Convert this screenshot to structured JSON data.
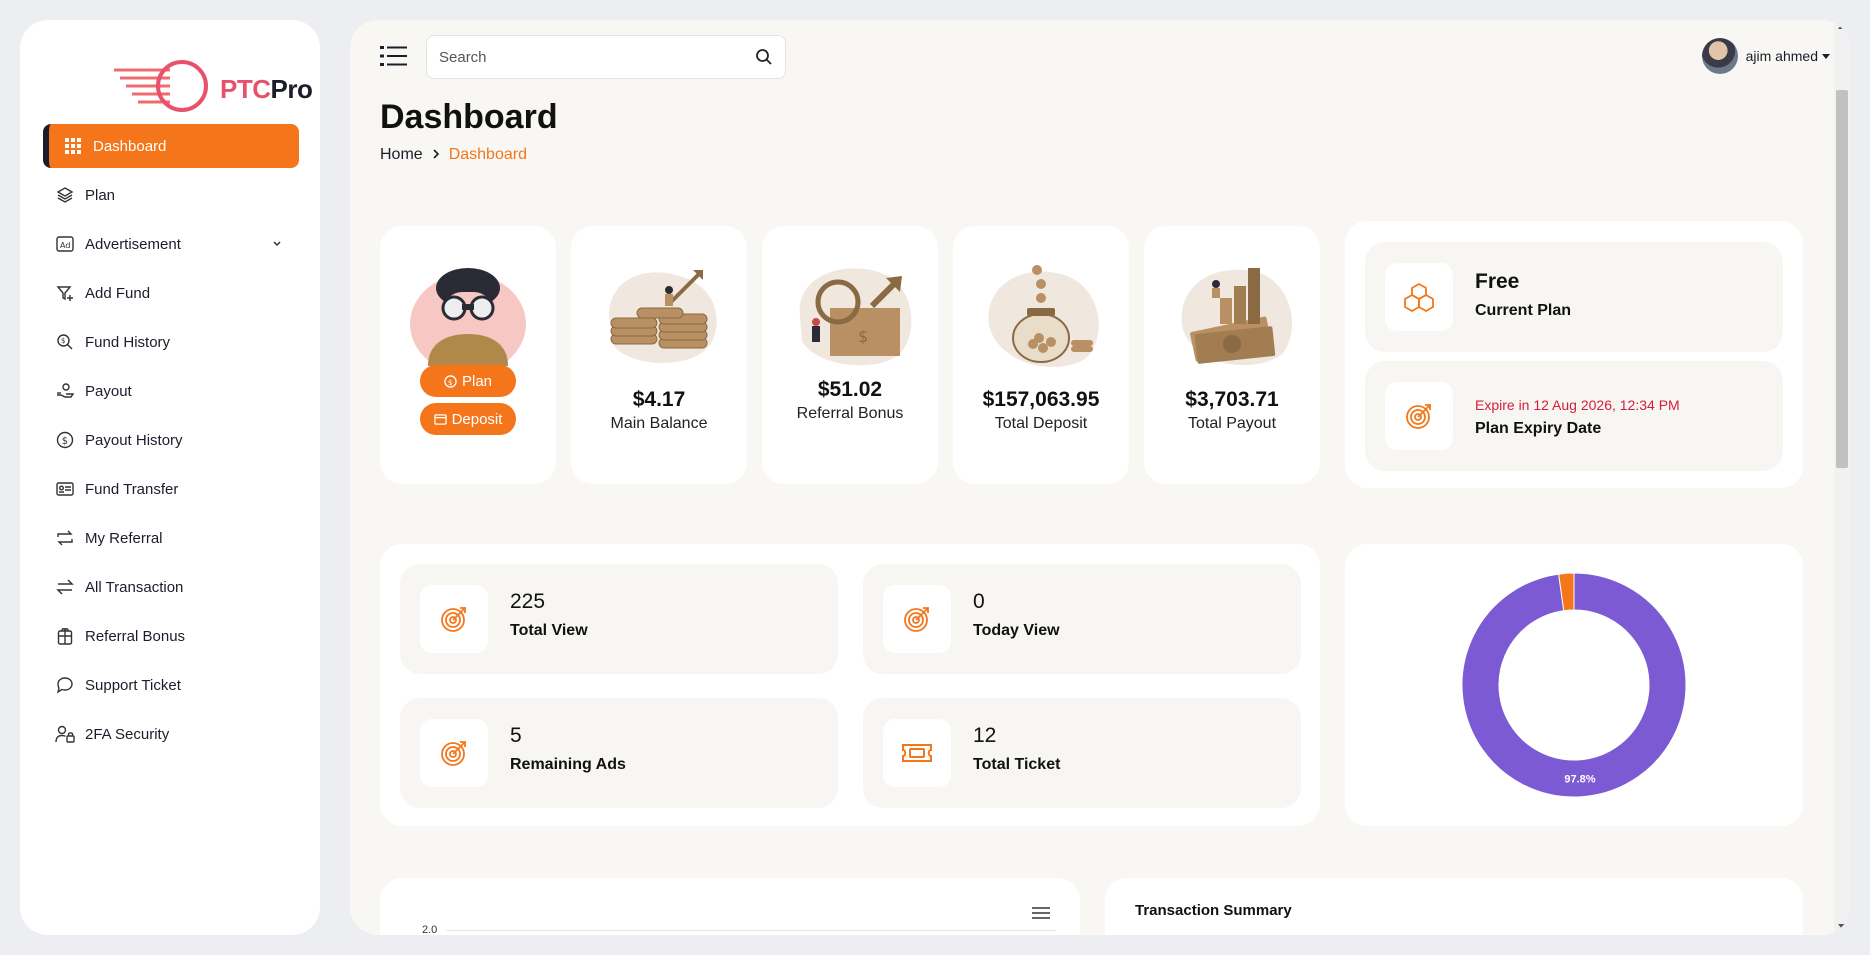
{
  "brand": {
    "logo_ptc": "PTC",
    "logo_pro": "Pro",
    "accent": "#f5761a",
    "dark": "#1b1d2b"
  },
  "sidebar": {
    "items": [
      {
        "label": "Dashboard",
        "icon": "grid-icon",
        "active": true
      },
      {
        "label": "Plan",
        "icon": "layers-icon"
      },
      {
        "label": "Advertisement",
        "icon": "ad-icon",
        "has_submenu": true
      },
      {
        "label": "Add Fund",
        "icon": "funnel-plus-icon"
      },
      {
        "label": "Fund History",
        "icon": "search-dollar-icon"
      },
      {
        "label": "Payout",
        "icon": "hand-coin-icon"
      },
      {
        "label": "Payout History",
        "icon": "dollar-circle-icon"
      },
      {
        "label": "Fund Transfer",
        "icon": "id-card-icon"
      },
      {
        "label": "My Referral",
        "icon": "repeat-icon"
      },
      {
        "label": "All Transaction",
        "icon": "swap-icon"
      },
      {
        "label": "Referral Bonus",
        "icon": "gift-icon"
      },
      {
        "label": "Support Ticket",
        "icon": "chat-bubble-icon"
      },
      {
        "label": "2FA Security",
        "icon": "user-lock-icon"
      }
    ]
  },
  "topbar": {
    "search_placeholder": "Search",
    "user_name": "ajim ahmed"
  },
  "page": {
    "title": "Dashboard",
    "breadcrumb_home": "Home",
    "breadcrumb_current": "Dashboard"
  },
  "actions": {
    "plan_label": "Plan",
    "deposit_label": "Deposit"
  },
  "stats": [
    {
      "value": "$4.17",
      "label": "Main Balance"
    },
    {
      "value": "$51.02",
      "label": "Referral Bonus"
    },
    {
      "value": "$157,063.95",
      "label": "Total Deposit"
    },
    {
      "value": "$3,703.71",
      "label": "Total Payout"
    }
  ],
  "plan": {
    "name": "Free",
    "name_caption": "Current Plan",
    "expiry_text": "Expire in 12 Aug 2026, 12:34 PM",
    "expiry_caption": "Plan Expiry Date"
  },
  "views": [
    {
      "value": "225",
      "label": "Total View",
      "icon": "target-icon"
    },
    {
      "value": "0",
      "label": "Today View",
      "icon": "target-icon"
    },
    {
      "value": "5",
      "label": "Remaining Ads",
      "icon": "target-icon"
    },
    {
      "value": "12",
      "label": "Total Ticket",
      "icon": "ticket-icon"
    }
  ],
  "chart_data": {
    "type": "pie",
    "labels": [
      "",
      ""
    ],
    "values": [
      97.8,
      2.2
    ],
    "colors": [
      "#7b5ad3",
      "#f5761a"
    ],
    "data_labels": [
      "97.8%"
    ],
    "donut": true
  },
  "bottom": {
    "y_tick_top": "2.0",
    "summary_title": "Transaction Summary"
  }
}
